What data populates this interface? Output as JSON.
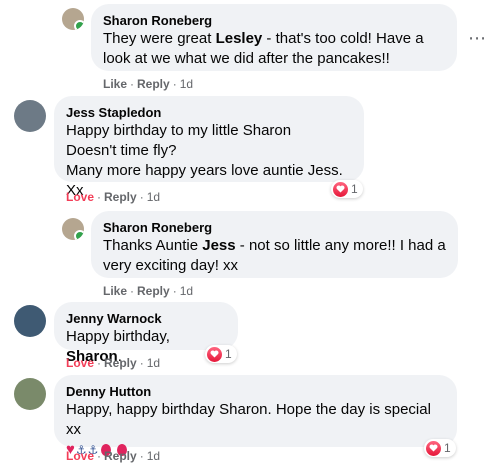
{
  "comments": [
    {
      "author": "Sharon Roneberg",
      "text_lines": [
        "They were great ",
        "Lesley",
        " - that's too cold! Have a",
        "look at we what we did after the pancakes!!"
      ],
      "actions": {
        "first": "Like",
        "second": "Reply",
        "time": "1d"
      },
      "online": true
    },
    {
      "author": "Jess Stapledon",
      "text": "Happy birthday to my little Sharon\nDoesn't time fly?\nMany more happy years love auntie Jess. Xx",
      "actions": {
        "first": "Love",
        "second": "Reply",
        "time": "1d"
      },
      "reaction_count": "1"
    },
    {
      "author": "Sharon Roneberg",
      "text_parts": [
        "Thanks Auntie ",
        "Jess",
        " - not so little any more!! I had a",
        "very exciting day! xx"
      ],
      "actions": {
        "first": "Like",
        "second": "Reply",
        "time": "1d"
      },
      "online": true
    },
    {
      "author": "Jenny Warnock",
      "text_parts": [
        "Happy birthday, ",
        "Sharon",
        "."
      ],
      "actions": {
        "first": "Love",
        "second": "Reply",
        "time": "1d"
      },
      "reaction_count": "1"
    },
    {
      "author": "Denny Hutton",
      "text": "Happy, happy birthday Sharon. Hope the day is special xx",
      "emoji": "♥⚓⚓🎈🎈",
      "actions": {
        "first": "Love",
        "second": "Reply",
        "time": "1d"
      },
      "reaction_count": "1"
    }
  ],
  "more_icon": "more-horizontal-icon",
  "colors": {
    "bubble": "#f0f2f5",
    "love": "#f33e58",
    "muted": "#65676b",
    "online": "#31a24c"
  }
}
